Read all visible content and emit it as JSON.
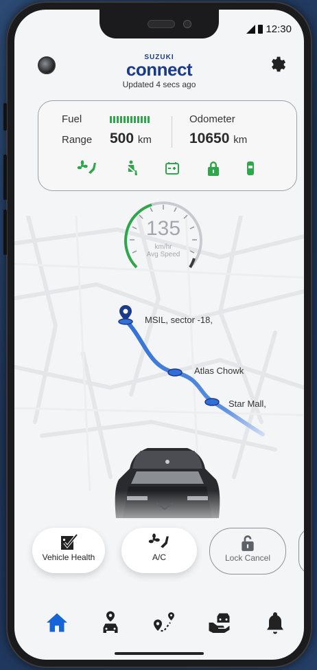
{
  "status_bar": {
    "time": "12:30"
  },
  "header": {
    "brand_top": "SUZUKI",
    "brand_main": "connect",
    "updated": "Updated 4 secs ago"
  },
  "info_card": {
    "fuel_label": "Fuel",
    "fuel_level": 1.0,
    "range_label": "Range",
    "range_value": "500",
    "range_unit": "km",
    "odometer_label": "Odometer",
    "odometer_value": "10650",
    "odometer_unit": "km",
    "status_icons": [
      "ac-fan-icon",
      "seatbelt-icon",
      "battery-icon",
      "lock-icon",
      "door-icon"
    ]
  },
  "speed_gauge": {
    "value": "135",
    "unit": "km/hr",
    "caption": "Avg Speed"
  },
  "route": {
    "stops": [
      {
        "name": "MSIL, sector -18,"
      },
      {
        "name": "Atlas Chowk"
      },
      {
        "name": "Star Mall,"
      }
    ]
  },
  "actions": [
    {
      "label": "Vehicle Health",
      "icon": "vehicle-health-icon"
    },
    {
      "label": "A/C",
      "icon": "ac-fan-icon"
    },
    {
      "label": "Lock Cancel",
      "icon": "unlock-icon"
    }
  ],
  "bottom_nav": [
    "home-icon",
    "car-location-icon",
    "trip-route-icon",
    "hand-car-icon",
    "bell-icon"
  ],
  "colors": {
    "brand_blue": "#1b3a8a",
    "status_green": "#2ea64a",
    "route_blue": "#2f6fd6",
    "nav_active": "#1565d8"
  }
}
